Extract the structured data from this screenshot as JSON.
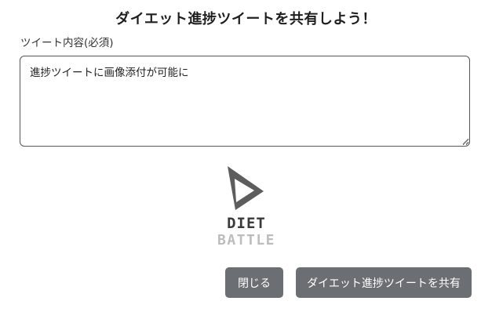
{
  "modal": {
    "title": "ダイエット進捗ツイートを共有しよう！",
    "field_label": "ツイート内容(必須)",
    "tweet_value": "進捗ツイートに画像添付が可能に",
    "logo": {
      "line1": "DIET",
      "line2": "BATTLE"
    },
    "buttons": {
      "close_label": "閉じる",
      "share_label": "ダイエット進捗ツイートを共有"
    }
  },
  "colors": {
    "button_bg": "#6b6e72",
    "logo_dark": "#3a3a3a",
    "logo_light": "#bdbdbd",
    "textarea_border": "#555555"
  }
}
